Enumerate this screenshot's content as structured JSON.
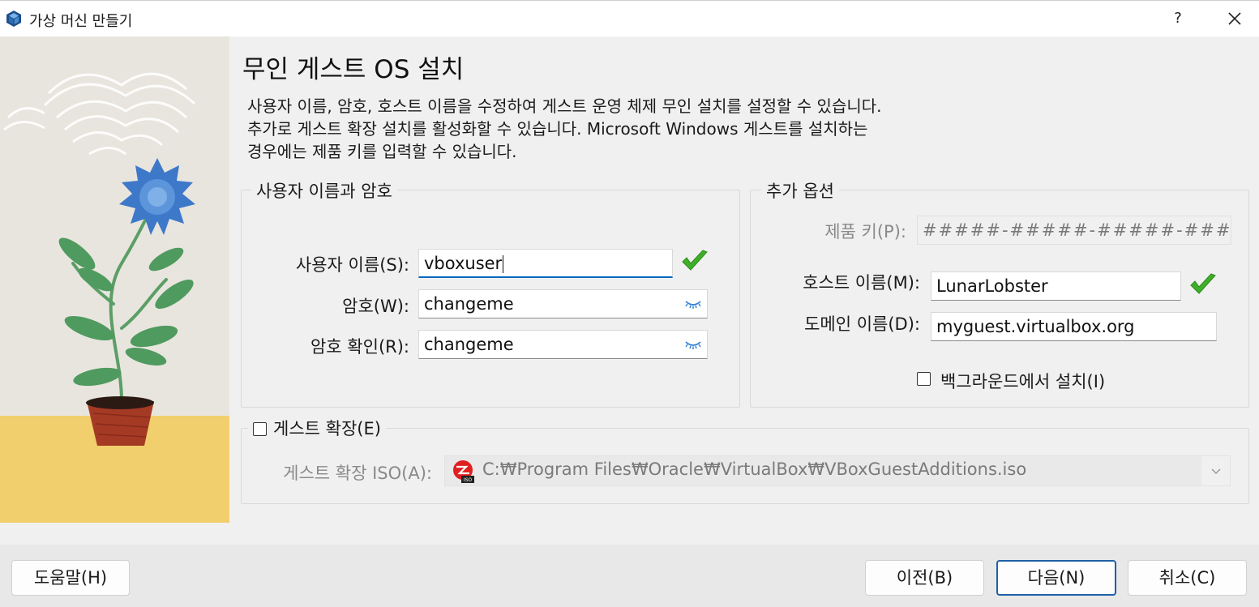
{
  "window": {
    "title": "가상 머신 만들기",
    "help_label": "?"
  },
  "page": {
    "title": "무인 게스트 OS 설치",
    "description_lines": [
      "사용자 이름, 암호, 호스트 이름을 수정하여 게스트 운영 체제 무인 설치를 설정할 수 있습니다.",
      "추가로 게스트 확장 설치를 활성화할 수 있습니다. Microsoft Windows 게스트를 설치하는",
      "경우에는 제품 키를 입력할 수 있습니다."
    ]
  },
  "credentials": {
    "group_title": "사용자 이름과 암호",
    "username_label": "사용자 이름(S):",
    "username_value": "vboxuser",
    "password_label": "암호(W):",
    "password_value": "changeme",
    "confirm_label": "암호 확인(R):",
    "confirm_value": "changeme"
  },
  "extra": {
    "group_title": "추가 옵션",
    "product_key_label": "제품 키(P):",
    "product_key_value": "#####-#####-#####-####",
    "hostname_label": "호스트 이름(M):",
    "hostname_value": "LunarLobster",
    "domain_label": "도메인 이름(D):",
    "domain_value": "myguest.virtualbox.org",
    "background_install_label": "백그라운드에서 설치(I)",
    "background_install_checked": false
  },
  "guest_additions": {
    "group_label": "게스트 확장(E)",
    "enabled": false,
    "iso_label": "게스트 확장 ISO(A):",
    "iso_path": "C:₩Program Files₩Oracle₩VirtualBox₩VBoxGuestAdditions.iso"
  },
  "buttons": {
    "help": "도움말(H)",
    "back": "이전(B)",
    "next": "다음(N)",
    "cancel": "취소(C)"
  },
  "colors": {
    "accent": "#0067c0",
    "valid_check": "#3fae29",
    "default_button_border": "#1f5fa8"
  }
}
